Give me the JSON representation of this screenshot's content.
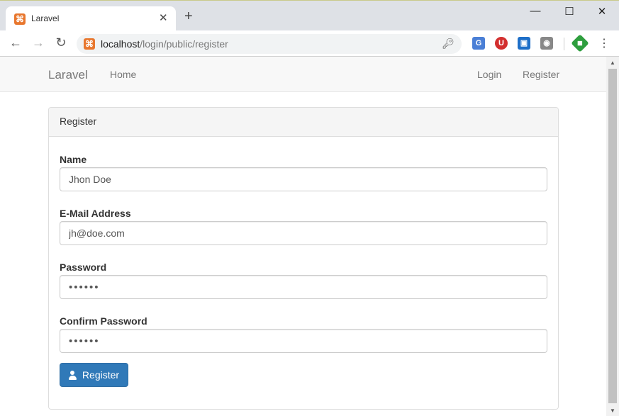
{
  "browser": {
    "tab_title": "Laravel",
    "tab_close": "✕",
    "new_tab": "+",
    "url_host": "localhost",
    "url_path": "/login/public/register",
    "window_controls": {
      "minimize": "—",
      "maximize": "☐",
      "close": "✕"
    },
    "extensions": [
      "translate-icon",
      "adblock-icon",
      "screenshot-icon",
      "camera-icon",
      "vpn-icon"
    ]
  },
  "navbar": {
    "brand": "Laravel",
    "home": "Home",
    "login": "Login",
    "register": "Register"
  },
  "panel": {
    "heading": "Register"
  },
  "form": {
    "name_label": "Name",
    "name_value": "Jhon Doe",
    "email_label": "E-Mail Address",
    "email_value": "jh@doe.com",
    "password_label": "Password",
    "password_value": "••••••",
    "confirm_label": "Confirm Password",
    "confirm_value": "••••••",
    "submit_label": "Register"
  },
  "colors": {
    "primary_button": "#3079b8",
    "xampp_favicon": "#e8772e"
  }
}
